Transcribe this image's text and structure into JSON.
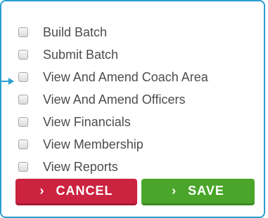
{
  "permissions": {
    "items": [
      {
        "label": "Build Batch",
        "checked": false
      },
      {
        "label": "Submit Batch",
        "checked": false
      },
      {
        "label": "View And Amend Coach Area",
        "checked": false
      },
      {
        "label": "View And Amend Officers",
        "checked": false
      },
      {
        "label": "View Financials",
        "checked": false
      },
      {
        "label": "View Membership",
        "checked": false
      },
      {
        "label": "View Reports",
        "checked": false
      }
    ]
  },
  "actions": {
    "cancel_label": "CANCEL",
    "save_label": "SAVE",
    "chevron_icon": "chevron-right-icon"
  },
  "colors": {
    "border_accent": "#2a9fd0",
    "cancel_bg": "#cc2340",
    "save_bg": "#4aa52a",
    "label_text": "#4c4c4c"
  }
}
